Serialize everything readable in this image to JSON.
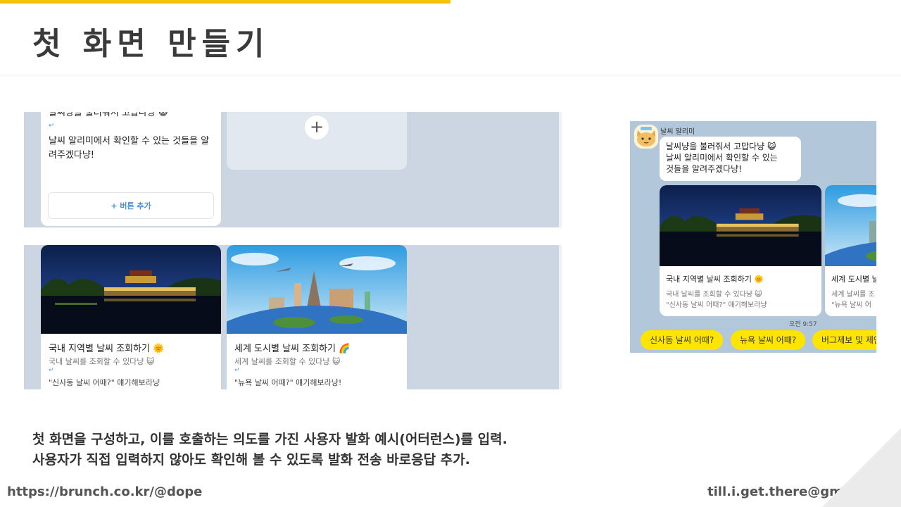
{
  "slide": {
    "title": "첫 화면 만들기",
    "description_line1": "첫 화면을 구성하고, 이를 호출하는 의도를 가진 사용자 발화 예시(어터런스)를 입력.",
    "description_line2": "사용자가 직접 입력하지 않아도 확인해 볼 수 있도록 발화 전송 바로응답 추가.",
    "footer_left": "https://brunch.co.kr/@dope",
    "footer_right": "till.i.get.there@gmail.com",
    "accent_color": "#f5c400"
  },
  "builder_top": {
    "text_line1": "날씨냥을 불러줘서 고맙다냥 😺",
    "return_mark": "↵",
    "text_line2": "날씨 알리미에서 확인할 수 있는 것들을 알려주겠다냥!",
    "add_button_label": "+ 버튼 추가",
    "add_card_symbol": "+"
  },
  "builder_bottom": {
    "cards": [
      {
        "title": "국내 지역별 날씨 조회하기 🌞",
        "subtitle": "국내 날씨를 조회할 수 있다냥 😺",
        "return_mark": "↵",
        "example": "\"신사동 날씨 어때?\" 얘기해보라냥"
      },
      {
        "title": "세계 도시별 날씨 조회하기 🌈",
        "subtitle": "세계 날씨를 조회할 수 있다냥 😺",
        "return_mark": "↵",
        "example": "\"뉴욕 날씨 어때?\" 얘기해보라냥!"
      }
    ]
  },
  "chat_preview": {
    "sender": "날씨 알리미",
    "bubble_line1": "날씨냥을 불러줘서 고맙다냥 😺",
    "bubble_line2": "날씨 알리미에서 확인할 수 있는",
    "bubble_line3": "것들을 알려주겠다냥!",
    "cards": [
      {
        "title": "국내 지역별 날씨 조회하기 🌞",
        "subtitle": "국내 날씨를 조회할 수 있다냥 😺",
        "example": "\"신사동 날씨 어때?\" 얘기해보라냥"
      },
      {
        "title": "세계 도시별 날",
        "subtitle": "세계 날씨를 조",
        "example": "\"뉴욕 날씨 어"
      }
    ],
    "timestamp": "오전 9:57",
    "quick_replies": [
      "신사동 날씨 어때?",
      "뉴욕 날씨 어때?",
      "버그제보 및 제안"
    ]
  }
}
